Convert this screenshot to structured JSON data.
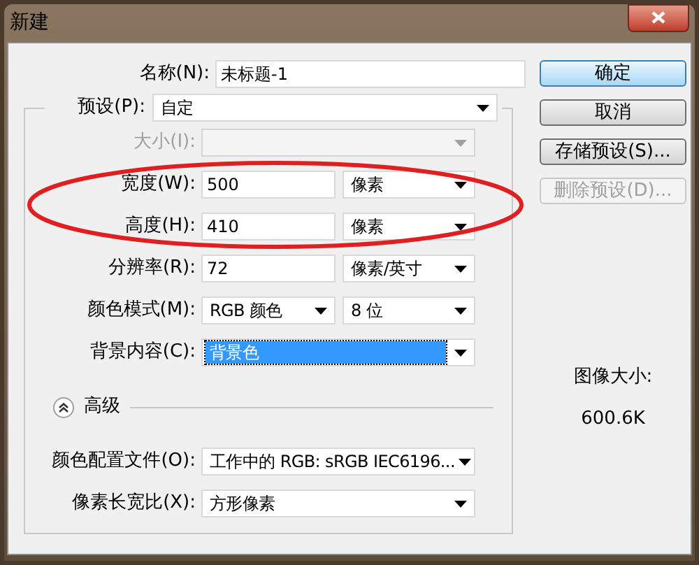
{
  "window": {
    "title": "新建"
  },
  "name": {
    "label": "名称(N):",
    "value": "未标题-1"
  },
  "preset": {
    "label": "预设(P):",
    "value": "自定"
  },
  "rows": [
    {
      "label": "大小(I):",
      "disabled": true,
      "focused": false,
      "controls": [
        {
          "kind": "select"
        }
      ]
    },
    {
      "label": "宽度(W):",
      "disabled": false,
      "focused": false,
      "controls": [
        {
          "kind": "input",
          "value": "500"
        },
        {
          "kind": "select",
          "value": "像素"
        }
      ]
    },
    {
      "label": "高度(H):",
      "disabled": false,
      "focused": false,
      "controls": [
        {
          "kind": "input",
          "value": "410"
        },
        {
          "kind": "select",
          "value": "像素"
        }
      ]
    },
    {
      "label": "分辨率(R):",
      "disabled": false,
      "focused": false,
      "controls": [
        {
          "kind": "input",
          "value": "72"
        },
        {
          "kind": "select",
          "value": "像素/英寸"
        }
      ]
    },
    {
      "label": "颜色模式(M):",
      "disabled": false,
      "focused": false,
      "controls": [
        {
          "kind": "select",
          "value": "RGB 颜色"
        },
        {
          "kind": "select",
          "value": "8 位"
        }
      ]
    },
    {
      "label": "背景内容(C):",
      "disabled": false,
      "focused": true,
      "controls": [
        {
          "kind": "select",
          "value": "背景色"
        }
      ]
    }
  ],
  "advanced": {
    "label": "高级",
    "expanded": true
  },
  "advanced_rows": [
    {
      "label": "颜色配置文件(O):",
      "disabled": false,
      "focused": false,
      "controls": [
        {
          "kind": "select",
          "value": "工作中的 RGB: sRGB IEC6196..."
        }
      ]
    },
    {
      "label": "像素长宽比(X):",
      "disabled": false,
      "focused": false,
      "controls": [
        {
          "kind": "select",
          "value": "方形像素"
        }
      ]
    }
  ],
  "buttons": [
    {
      "label": "确定",
      "default": true,
      "disabled": false
    },
    {
      "label": "取消",
      "default": false,
      "disabled": false
    },
    {
      "label": "存储预设(S)...",
      "default": false,
      "disabled": false
    },
    {
      "label": "删除预设(D)...",
      "default": false,
      "disabled": true
    }
  ],
  "image_size": {
    "label": "图像大小:",
    "value": "600.6K"
  }
}
